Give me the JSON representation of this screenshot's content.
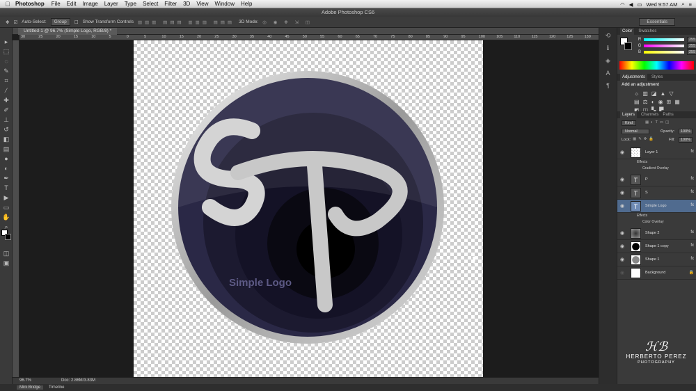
{
  "menubar": {
    "app_name": "Photoshop",
    "items": [
      "File",
      "Edit",
      "Image",
      "Layer",
      "Type",
      "Select",
      "Filter",
      "3D",
      "View",
      "Window",
      "Help"
    ],
    "clock": "Wed 9:57 AM"
  },
  "titlebar": {
    "title": "Adobe Photoshop CS6"
  },
  "options_bar": {
    "auto_select_label": "Auto-Select:",
    "auto_select_value": "Group",
    "show_transform_label": "Show Transform Controls",
    "mode_3d_label": "3D Mode:",
    "workspace_value": "Essentials"
  },
  "document": {
    "tab_title": "Untitled-1 @ 96.7% (Simple Logo, RGB/8) *",
    "ruler_ticks": [
      "30",
      "25",
      "20",
      "15",
      "10",
      "5",
      "0",
      "5",
      "10",
      "15",
      "20",
      "25",
      "30",
      "35",
      "40",
      "45",
      "50",
      "55",
      "60",
      "65",
      "70",
      "75",
      "80",
      "85",
      "90",
      "95",
      "100",
      "105",
      "110",
      "115",
      "120",
      "125",
      "130"
    ]
  },
  "artwork": {
    "monogram": "SP",
    "logo_text": "Simple Logo"
  },
  "status_bar": {
    "zoom": "96.7%",
    "doc_info": "Doc: 2.86M/3.83M"
  },
  "bottom_tabs": [
    "Mini Bridge",
    "Timeline"
  ],
  "color_panel": {
    "tabs": [
      "Color",
      "Swatches"
    ],
    "r_label": "R",
    "r_value": "255",
    "g_label": "G",
    "g_value": "255",
    "b_label": "B",
    "b_value": "255"
  },
  "adjustments_panel": {
    "tabs": [
      "Adjustments",
      "Styles"
    ],
    "hint": "Add an adjustment"
  },
  "layers_panel": {
    "tabs": [
      "Layers",
      "Channels",
      "Paths"
    ],
    "kind_label": "Kind",
    "blend_mode": "Normal",
    "opacity_label": "Opacity:",
    "opacity_value": "100%",
    "lock_label": "Lock:",
    "fill_label": "Fill:",
    "fill_value": "100%",
    "layers": [
      {
        "name": "Layer 1",
        "effects_label": "Effects",
        "effect": "Gradient Overlay"
      },
      {
        "name": "P"
      },
      {
        "name": "S"
      },
      {
        "name": "Simple Logo",
        "effects_label": "Effects",
        "effect": "Color Overlay",
        "selected": true
      },
      {
        "name": "Shape 2"
      },
      {
        "name": "Shape 1 copy"
      },
      {
        "name": "Shape 1"
      },
      {
        "name": "Background"
      }
    ]
  },
  "watermark": {
    "name": "HERBERTO PEREZ",
    "subtitle": "PHOTOGRAPHY"
  },
  "colors": {
    "accent_selection": "#506b8f",
    "logo_ring_dark": "#1a1830",
    "logo_ring_light": "#3a3560"
  }
}
